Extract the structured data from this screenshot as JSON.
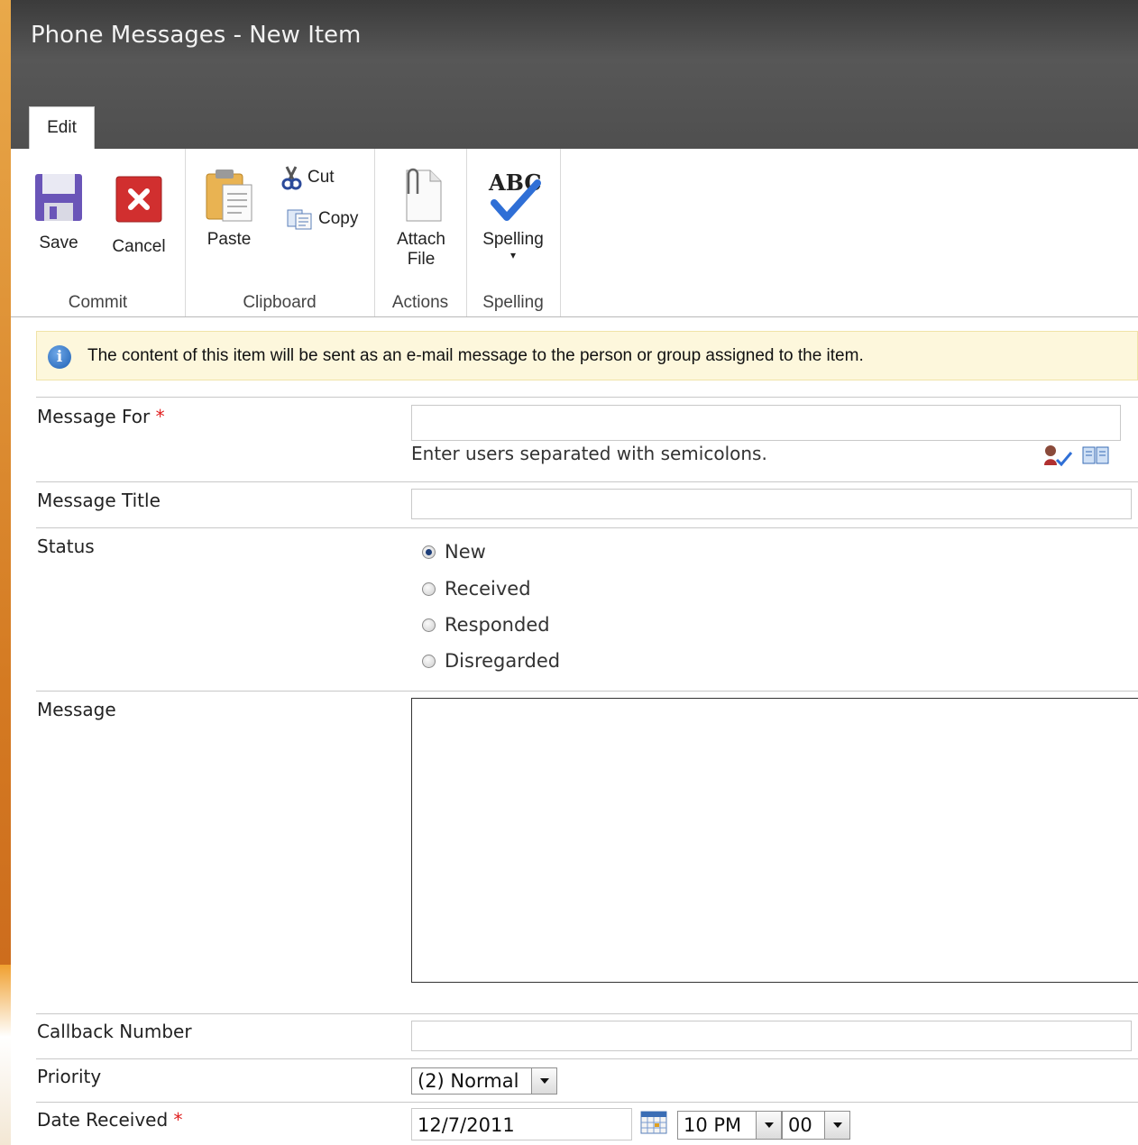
{
  "window": {
    "title": "Phone Messages - New Item"
  },
  "tabs": [
    {
      "label": "Edit",
      "active": true
    }
  ],
  "ribbon": {
    "commit": {
      "label": "Commit",
      "save": "Save",
      "cancel": "Cancel"
    },
    "clipboard": {
      "label": "Clipboard",
      "paste": "Paste",
      "cut": "Cut",
      "copy": "Copy"
    },
    "actions": {
      "label": "Actions",
      "attach_line1": "Attach",
      "attach_line2": "File"
    },
    "spelling": {
      "label": "Spelling",
      "button": "Spelling",
      "icon_text": "ABC"
    }
  },
  "info": {
    "text": "The content of this item will be sent as an e-mail message to the person or group assigned to the item."
  },
  "form": {
    "message_for": {
      "label": "Message For",
      "required_mark": "*",
      "value": "",
      "hint": "Enter users separated with semicolons."
    },
    "message_title": {
      "label": "Message Title",
      "value": ""
    },
    "status": {
      "label": "Status",
      "options": [
        "New",
        "Received",
        "Responded",
        "Disregarded"
      ],
      "selected": "New"
    },
    "message": {
      "label": "Message",
      "value": ""
    },
    "callback_number": {
      "label": "Callback Number",
      "value": ""
    },
    "priority": {
      "label": "Priority",
      "value": "(2) Normal"
    },
    "date_received": {
      "label": "Date Received",
      "required_mark": "*",
      "date": "12/7/2011",
      "hour": "10 PM",
      "minute": "00"
    }
  },
  "colors": {
    "title_bar": "#4f4f4f",
    "info_bg": "#fdf7dc",
    "required": "#e02020",
    "page_bg": "#d98a2a"
  }
}
